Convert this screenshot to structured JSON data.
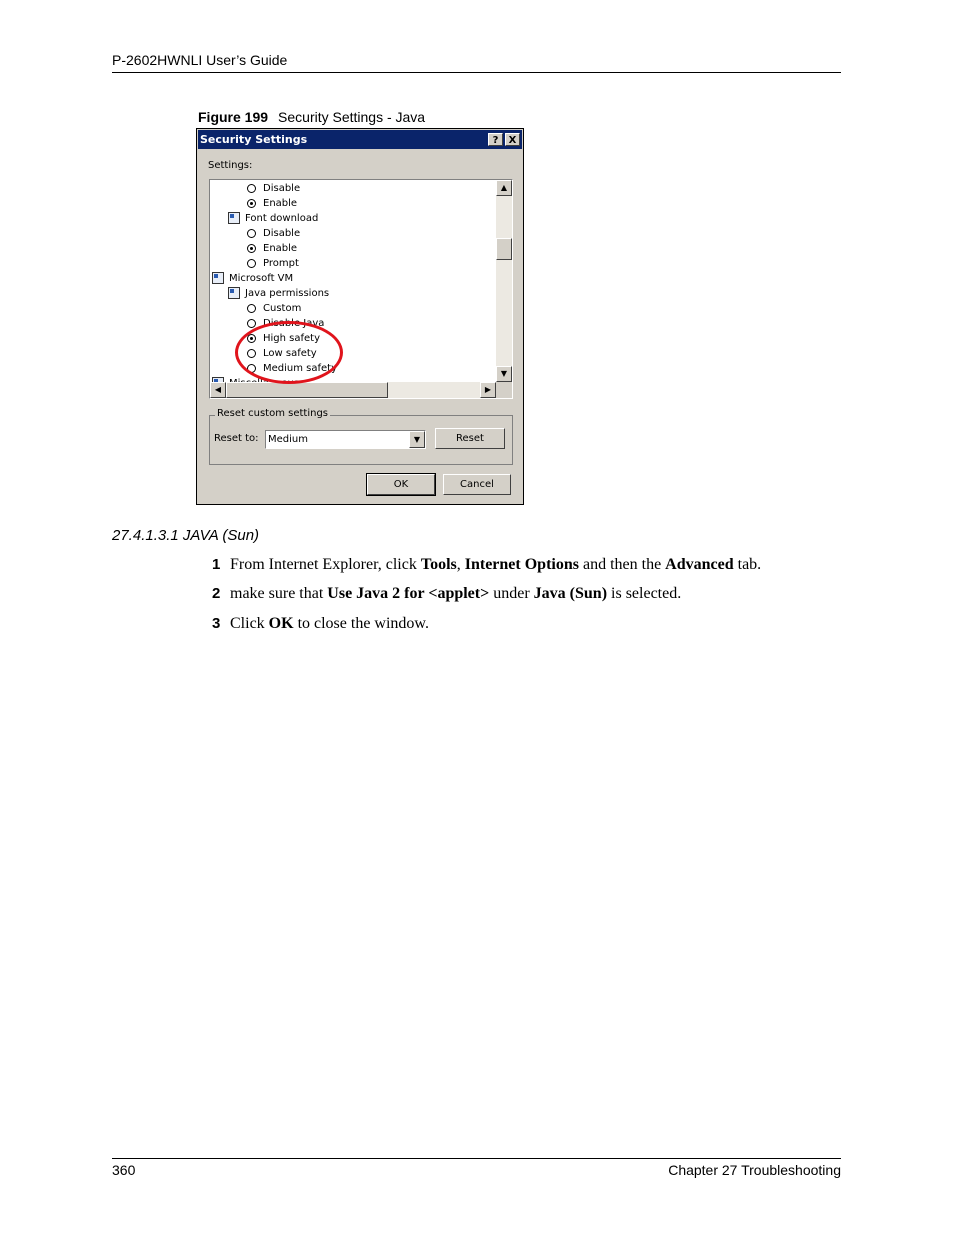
{
  "header": {
    "title": "P-2602HWNLI User’s Guide"
  },
  "figure": {
    "label": "Figure 199",
    "caption": "Security Settings - Java"
  },
  "dialog": {
    "title": "Security Settings",
    "help_btn": "?",
    "close_btn": "X",
    "settings_label": "Settings:",
    "list_items": [
      {
        "text": "Disable",
        "kind": "radio",
        "checked": false,
        "indent": 2
      },
      {
        "text": "Enable",
        "kind": "radio",
        "checked": true,
        "indent": 2
      },
      {
        "text": "Font download",
        "kind": "icon",
        "indent": 1
      },
      {
        "text": "Disable",
        "kind": "radio",
        "checked": false,
        "indent": 2
      },
      {
        "text": "Enable",
        "kind": "radio",
        "checked": true,
        "indent": 2
      },
      {
        "text": "Prompt",
        "kind": "radio",
        "checked": false,
        "indent": 2
      },
      {
        "text": "Microsoft VM",
        "kind": "icon",
        "indent": 0
      },
      {
        "text": "Java permissions",
        "kind": "icon",
        "indent": 1
      },
      {
        "text": "Custom",
        "kind": "radio",
        "checked": false,
        "indent": 2
      },
      {
        "text": "Disable Java",
        "kind": "radio",
        "checked": false,
        "indent": 2
      },
      {
        "text": "High safety",
        "kind": "radio",
        "checked": true,
        "indent": 2
      },
      {
        "text": "Low safety",
        "kind": "radio",
        "checked": false,
        "indent": 2
      },
      {
        "text": "Medium safety",
        "kind": "radio",
        "checked": false,
        "indent": 2
      },
      {
        "text": "Miscellaneous",
        "kind": "icon",
        "indent": 0
      }
    ],
    "reset_group_label": "Reset custom settings",
    "reset_to_label": "Reset to:",
    "reset_to_value": "Medium",
    "reset_button": "Reset",
    "ok_button": "OK",
    "cancel_button": "Cancel",
    "highlight_color": "#e0141c",
    "titlebar_color": "#0a246a"
  },
  "section": {
    "heading": "27.4.1.3.1  JAVA (Sun)"
  },
  "steps": [
    {
      "num": "1",
      "parts": [
        {
          "t": "From Internet Explorer, click ",
          "b": false
        },
        {
          "t": "Tools",
          "b": true
        },
        {
          "t": ", ",
          "b": false
        },
        {
          "t": "Internet Options",
          "b": true
        },
        {
          "t": " and then the ",
          "b": false
        },
        {
          "t": "Advanced",
          "b": true
        },
        {
          "t": " tab.",
          "b": false
        }
      ]
    },
    {
      "num": "2",
      "parts": [
        {
          "t": "make sure that ",
          "b": false
        },
        {
          "t": "Use Java 2 for <applet>",
          "b": true
        },
        {
          "t": " under ",
          "b": false
        },
        {
          "t": "Java (Sun)",
          "b": true
        },
        {
          "t": " is selected.",
          "b": false
        }
      ]
    },
    {
      "num": "3",
      "parts": [
        {
          "t": "Click ",
          "b": false
        },
        {
          "t": "OK",
          "b": true
        },
        {
          "t": " to close the window.",
          "b": false
        }
      ]
    }
  ],
  "footer": {
    "page": "360",
    "chapter": "Chapter 27 Troubleshooting"
  }
}
